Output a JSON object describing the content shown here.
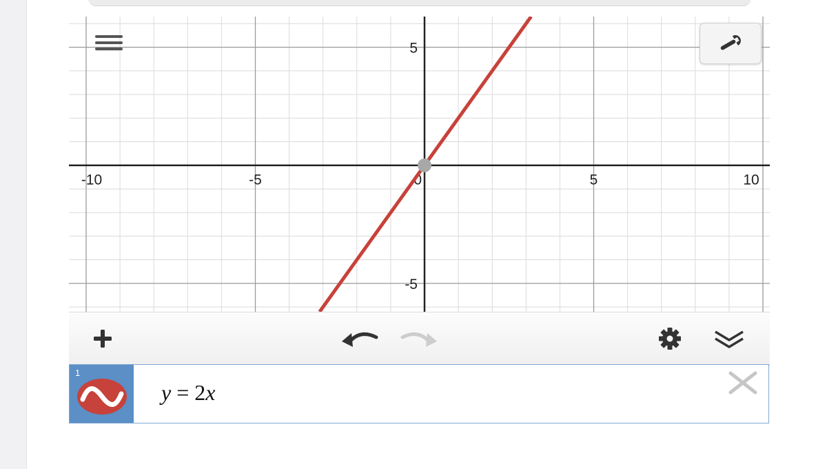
{
  "graph": {
    "x_ticks": [
      "-10",
      "-5",
      "0",
      "5",
      "10"
    ],
    "y_ticks": [
      "5",
      "-5"
    ],
    "curve_color": "#c7423a",
    "point_color": "#a8a8a8",
    "x_range": [
      -10,
      10
    ],
    "y_range": [
      -6.2,
      6.3
    ],
    "grid": true,
    "function": {
      "slope": 2,
      "intercept": 0
    },
    "highlight_point": [
      0,
      0
    ]
  },
  "toolbar": {
    "add_icon": "plus-icon",
    "undo_icon": "undo-icon",
    "redo_icon": "redo-icon",
    "settings_icon": "gear-icon",
    "collapse_icon": "double-chevron-down-icon"
  },
  "expression_list": [
    {
      "number": "1",
      "lhs": "y",
      "equals": "=",
      "coefficient": "2",
      "variable": "x",
      "color": "#c7423a",
      "tab_color": "#5b8fc6"
    }
  ],
  "colors": {
    "accent": "#5b8fc6",
    "curve": "#c7423a"
  }
}
